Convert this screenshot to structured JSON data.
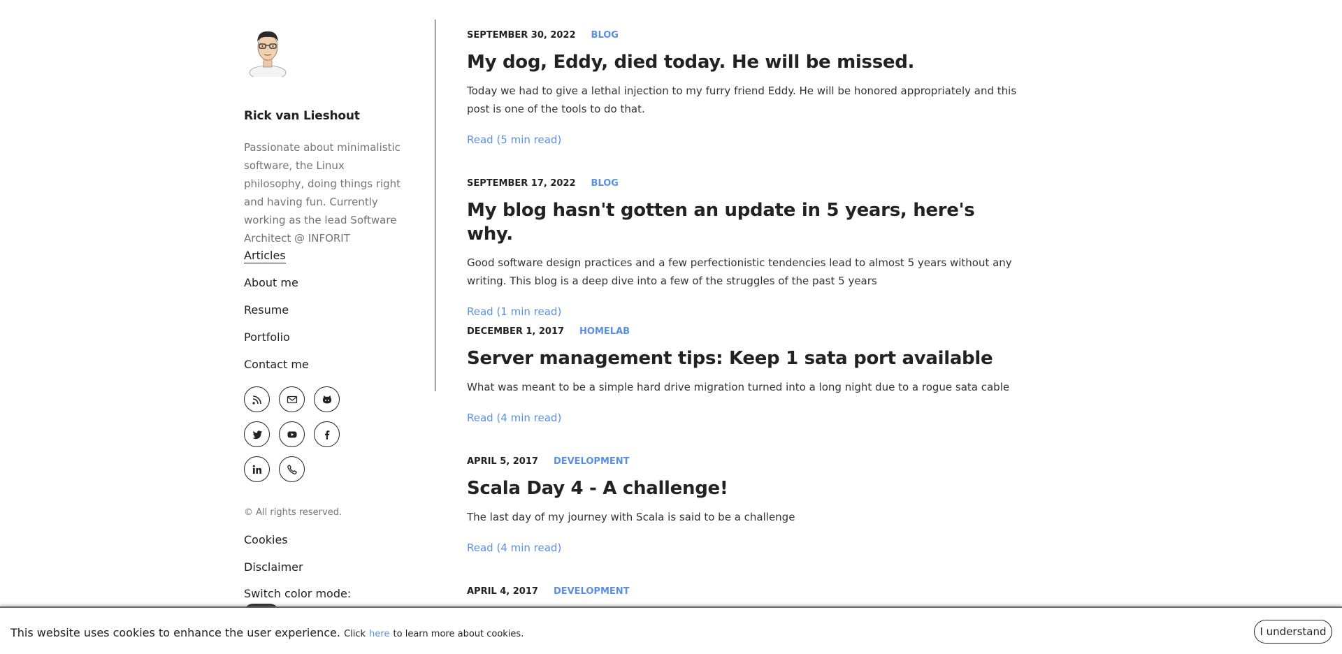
{
  "author": {
    "name": "Rick van Lieshout",
    "bio": "Passionate about minimalistic software, the Linux philosophy, doing things right and having fun. Currently working as the lead Software Architect @ INFORIT"
  },
  "nav": {
    "items": [
      {
        "label": "Articles",
        "active": true
      },
      {
        "label": "About me"
      },
      {
        "label": "Resume"
      },
      {
        "label": "Portfolio"
      },
      {
        "label": "Contact me"
      }
    ]
  },
  "social": {
    "icons": [
      "rss-icon",
      "mail-icon",
      "github-icon",
      "twitter-icon",
      "youtube-icon",
      "facebook-icon",
      "linkedin-icon",
      "phone-icon"
    ]
  },
  "footer": {
    "copyright": "© All rights reserved.",
    "cookies": "Cookies",
    "disclaimer": "Disclaimer",
    "color_mode_label": "Switch color mode:"
  },
  "posts": [
    {
      "date": "SEPTEMBER 30, 2022",
      "category": "BLOG",
      "title": "My dog, Eddy, died today. He will be missed.",
      "excerpt": "Today we had to give a lethal injection to my furry friend Eddy. He will be honored appropriately and this post is one of the tools to do that.",
      "read": "Read (5 min read)"
    },
    {
      "date": "SEPTEMBER 17, 2022",
      "category": "BLOG",
      "title": "My blog hasn't gotten an update in 5 years, here's why.",
      "excerpt": "Good software design practices and a few perfectionistic tendencies lead to almost 5 years without any writing. This blog is a deep dive into a few of the struggles of the past 5 years",
      "read": "Read (1 min read)"
    },
    {
      "date": "DECEMBER 1, 2017",
      "category": "HOMELAB",
      "title": "Server management tips: Keep 1 sata port available",
      "excerpt": "What was meant to be a simple hard drive migration turned into a long night due to a rogue sata cable",
      "read": "Read (4 min read)"
    },
    {
      "date": "APRIL 5, 2017",
      "category": "DEVELOPMENT",
      "title": "Scala Day 4 - A challenge!",
      "excerpt": "The last day of my journey with Scala is said to be a challenge",
      "read": "Read (4 min read)"
    },
    {
      "date": "APRIL 4, 2017",
      "category": "DEVELOPMENT"
    }
  ],
  "cookie_banner": {
    "text": "This website uses cookies to enhance the user experience.",
    "click": "Click",
    "link": "here",
    "rest": "to learn more about cookies.",
    "button": "I understand"
  },
  "colors": {
    "accent": "#5a8fe0",
    "text": "#222222",
    "muted": "#737373"
  }
}
